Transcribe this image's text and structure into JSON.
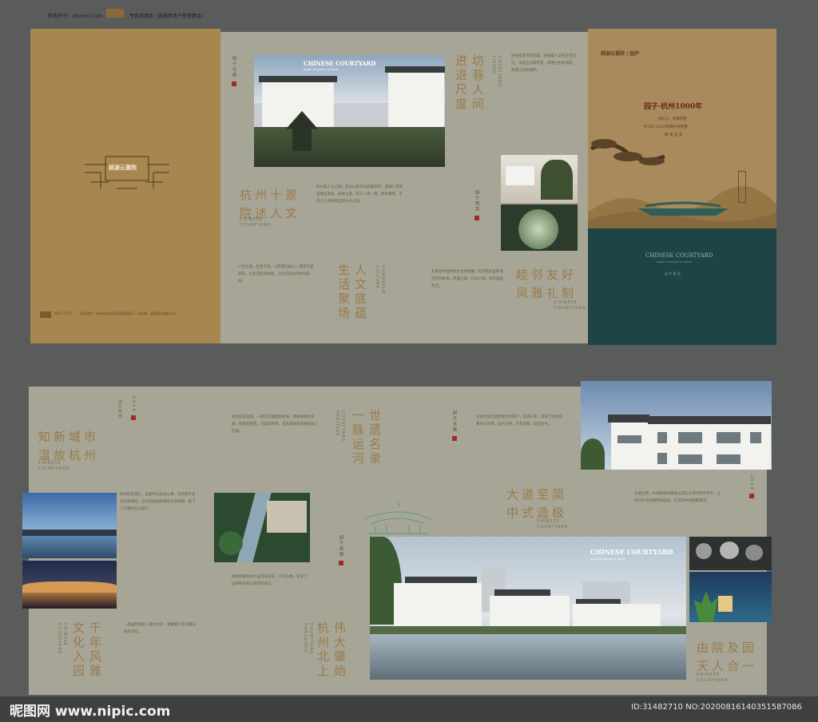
{
  "header": {
    "spec": "折页尺寸：16cm×27cm",
    "color_note": "专色烫银金（色按参考户型烫黄金）"
  },
  "cover_back": {
    "logo": "桃源云熹院",
    "footer_phone": "0571-2777",
    "footer_address": "项目地址：杭州市余杭区某某路某某号 · 开发商：某某置业有限公司"
  },
  "spread1": {
    "photo1_title": "CHINESE COURTYARD",
    "photo1_sub": "BASED ON ORIGIN OF TRADE",
    "tag1": "园子元朝",
    "t1": "杭州十景",
    "t1b": "院述人文",
    "t1_en": "CHINESE\nCOURTYARD",
    "p1": "杭州是人文之城，自古以来文化底蕴深厚，西湖十景更是闻名遐迩。园林之美，在于一步一景，移步换景，于方寸之间感受自然山水之韵。",
    "t2": "坊巷人间",
    "t2b": "进退尺度",
    "t2_en": "COURTYARD\nLIVING",
    "p2": "坊巷是城市的肌理，承载着人们的生活记忆。进退之间有尺度，街巷之中有温度，院落之内有情怀。",
    "tag2": "园子明清",
    "t3": "人文底蕴",
    "t3b": "生活聚场",
    "t3_en": "HUMANISM\nCULTURE",
    "p3": "人文之美，生生不息。以院落为核心，重塑邻里关系，让生活回归本真，让文化得以传承与延续。",
    "t4": "睦邻友好",
    "t4b": "风雅礼制",
    "t4_en": "CHINESE\nCOURTYARD",
    "p4": "礼制是中国传统文化的精髓，睦邻友好是和谐社区的根本。风雅之居，礼乐之地，共享园居生活。"
  },
  "cover_front": {
    "logo": "桃源云熹院",
    "logo2": "园庐",
    "slogan": "园子·杭州1000年",
    "line1": "城东正 · 纯粹院墅",
    "line2": "约185-230㎡纯粹中式院墅",
    "line3": "敬 请 品 鉴",
    "en_title": "CHINESE COURTYARD",
    "en_sub": "BASED ON ORIGIN OF TRADE",
    "bottom": "园 庐 雅 居"
  },
  "spread2": {
    "year1": "2019",
    "tag_a": "城东新城",
    "t5": "知新城市",
    "t5b": "温故杭州",
    "t5_en": "CHINESE\nCOURTYARD",
    "p5": "杭州城东新城，一座正在崛起的新城。拥有便捷的交通、完善的配套、优美的环境，是未来城市发展的核心区域。",
    "t6": "世遗名录",
    "t6b": "一脉运河",
    "t6_en": "COURTYARD\nHERITAGE",
    "tag_b": "园子宋朝",
    "p6": "京杭大运河是世界文化遗产，流淌千年，孕育了杭州的繁华与文明。运河之畔，千年文脉，延续至今。",
    "t7": "大道至简",
    "t7b": "中式造极",
    "t7_en": "CHINESE\nCOURTYARD",
    "year2": "2019",
    "p7": "大道至简，中式建筑的极致之美在于简约而不简单，以现代手法诠释传统韵味，打造新中式院墅典范。",
    "p8": "杭州历史悠久，自秦时设县治以来，已有两千多年的建城史。五代吴越国和南宋在此建都，留下了丰富的文化遗产。",
    "t8": "千年风雅",
    "t8b": "文化入园",
    "t8_en": "CHINESE\nCOURTYARD",
    "tag_c": "园子唐朝",
    "p9": "一座园林就是一部文化史，承载着千年风雅与城市记忆。",
    "p10": "拱宸桥是杭州大运河的标志，千年古桥，见证了运河的兴衰与城市的变迁。",
    "t9": "伟大肇始",
    "t9b": "杭州北上",
    "t9_en": "COURTYARD\nHANGZHOU",
    "photo2_title": "CHINESE COURTYARD",
    "photo2_sub": "BASED ON ORIGIN OF TRADE",
    "t10": "由院及园",
    "t10b": "天人合一",
    "t10_en": "CHINESE\nCOURTYARD"
  },
  "watermark": {
    "site": "昵图网 www.nipic.com",
    "id": "ID:31482710 NO:20200816140351587086"
  }
}
